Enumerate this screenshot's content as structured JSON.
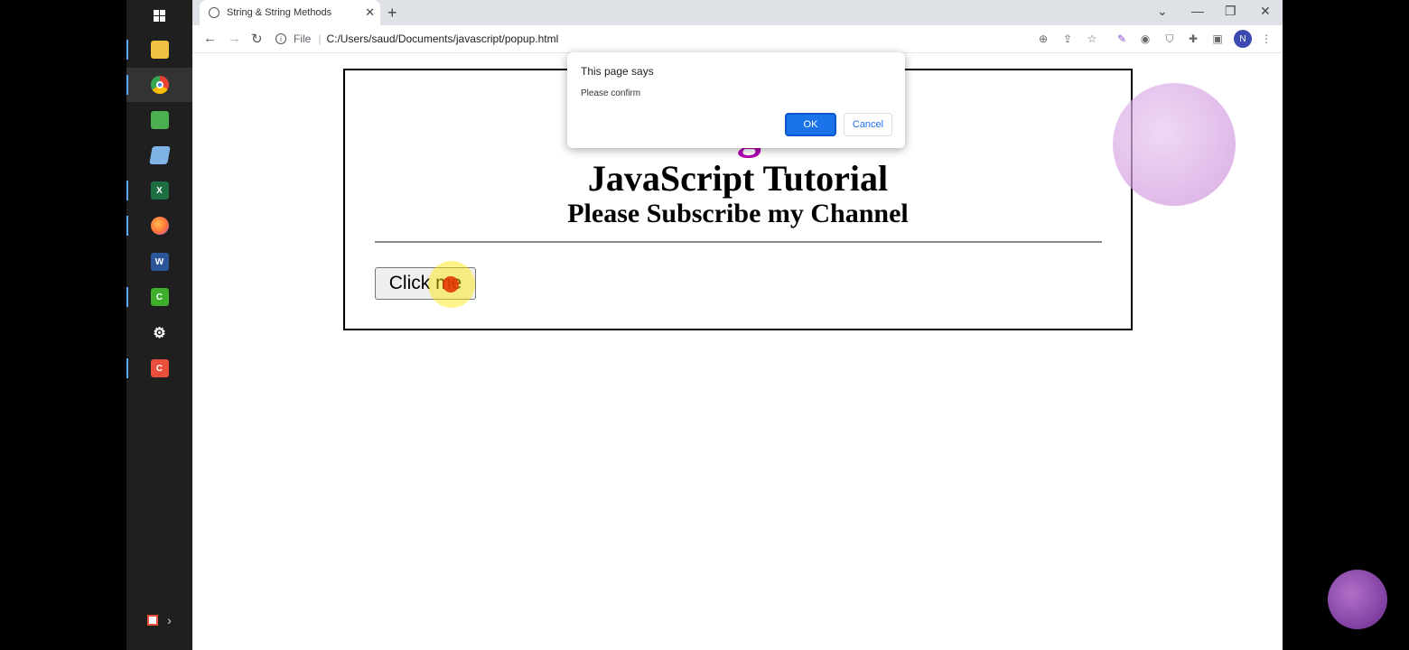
{
  "taskbar": {
    "items": [
      {
        "name": "windows-start-icon",
        "color": "#ffffff"
      },
      {
        "name": "file-explorer-icon",
        "color": "#f0c040"
      },
      {
        "name": "chrome-icon",
        "color": "#34a853"
      },
      {
        "name": "photos-icon",
        "color": "#4caf50"
      },
      {
        "name": "notepad-icon",
        "color": "#7fb2e5"
      },
      {
        "name": "excel-icon",
        "color": "#1d6f42"
      },
      {
        "name": "firefox-icon",
        "color": "#ff7139"
      },
      {
        "name": "word-icon",
        "color": "#2b579a"
      },
      {
        "name": "camtasia-icon",
        "color": "#3fae2a"
      },
      {
        "name": "settings-icon",
        "color": "#ffffff"
      },
      {
        "name": "camtasia-recorder-icon",
        "color": "#e94e3c"
      }
    ]
  },
  "browser": {
    "tab_title": "String & String Methods",
    "address_prefix": "File",
    "address": "C:/Users/saud/Documents/javascript/popup.html",
    "profile_initial": "N"
  },
  "page": {
    "brand_text": "T                       ge",
    "title": "JavaScript Tutorial",
    "subtitle": "Please Subscribe my Channel",
    "button_label": "Click me"
  },
  "dialog": {
    "title": "This page says",
    "message": "Please confirm",
    "ok_label": "OK",
    "cancel_label": "Cancel"
  },
  "colors": {
    "accent": "#1a73e8",
    "brand": "#b000b0"
  }
}
